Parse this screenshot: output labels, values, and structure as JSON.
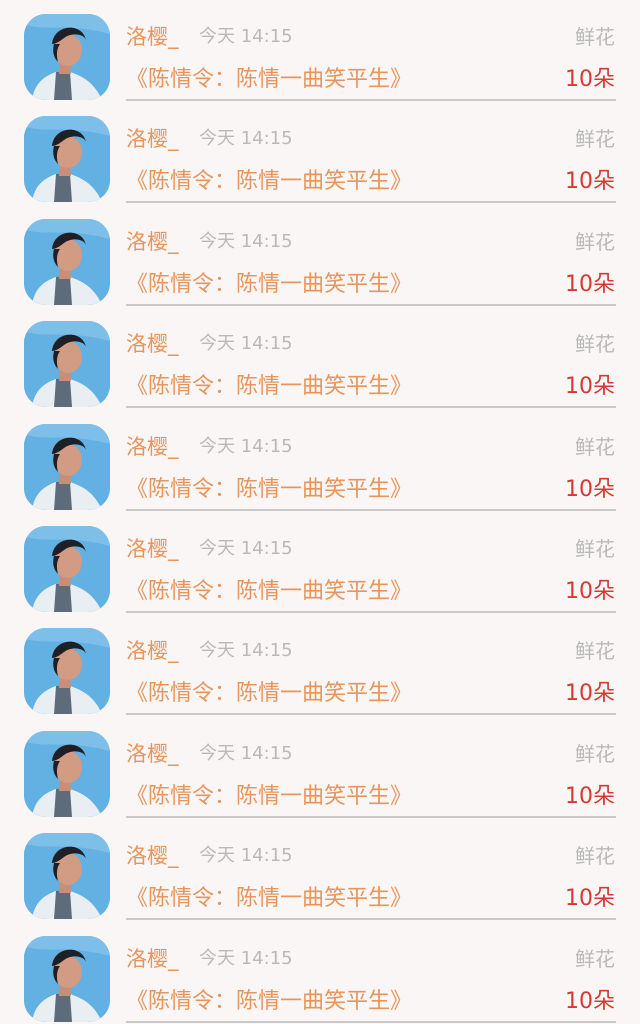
{
  "items": [
    {
      "username": "洛樱_",
      "time": "今天 14:15",
      "gift_type": "鲜花",
      "work_title": "《陈情令：陈情一曲笑平生》",
      "gift_count": "10朵",
      "avatar_icon": "user-avatar-photo"
    },
    {
      "username": "洛樱_",
      "time": "今天 14:15",
      "gift_type": "鲜花",
      "work_title": "《陈情令：陈情一曲笑平生》",
      "gift_count": "10朵",
      "avatar_icon": "user-avatar-photo"
    },
    {
      "username": "洛樱_",
      "time": "今天 14:15",
      "gift_type": "鲜花",
      "work_title": "《陈情令：陈情一曲笑平生》",
      "gift_count": "10朵",
      "avatar_icon": "user-avatar-photo"
    },
    {
      "username": "洛樱_",
      "time": "今天 14:15",
      "gift_type": "鲜花",
      "work_title": "《陈情令：陈情一曲笑平生》",
      "gift_count": "10朵",
      "avatar_icon": "user-avatar-photo"
    },
    {
      "username": "洛樱_",
      "time": "今天 14:15",
      "gift_type": "鲜花",
      "work_title": "《陈情令：陈情一曲笑平生》",
      "gift_count": "10朵",
      "avatar_icon": "user-avatar-photo"
    },
    {
      "username": "洛樱_",
      "time": "今天 14:15",
      "gift_type": "鲜花",
      "work_title": "《陈情令：陈情一曲笑平生》",
      "gift_count": "10朵",
      "avatar_icon": "user-avatar-photo"
    },
    {
      "username": "洛樱_",
      "time": "今天 14:15",
      "gift_type": "鲜花",
      "work_title": "《陈情令：陈情一曲笑平生》",
      "gift_count": "10朵",
      "avatar_icon": "user-avatar-photo"
    },
    {
      "username": "洛樱_",
      "time": "今天 14:15",
      "gift_type": "鲜花",
      "work_title": "《陈情令：陈情一曲笑平生》",
      "gift_count": "10朵",
      "avatar_icon": "user-avatar-photo"
    },
    {
      "username": "洛樱_",
      "time": "今天 14:15",
      "gift_type": "鲜花",
      "work_title": "《陈情令：陈情一曲笑平生》",
      "gift_count": "10朵",
      "avatar_icon": "user-avatar-photo"
    },
    {
      "username": "洛樱_",
      "time": "今天 14:15",
      "gift_type": "鲜花",
      "work_title": "《陈情令：陈情一曲笑平生》",
      "gift_count": "10朵",
      "avatar_icon": "user-avatar-photo"
    }
  ],
  "colors": {
    "background": "#faf6f6",
    "accent_orange": "#e8955b",
    "count_red": "#d33a32",
    "muted_gray": "#b9b9b9",
    "divider": "#c9c9c9"
  }
}
